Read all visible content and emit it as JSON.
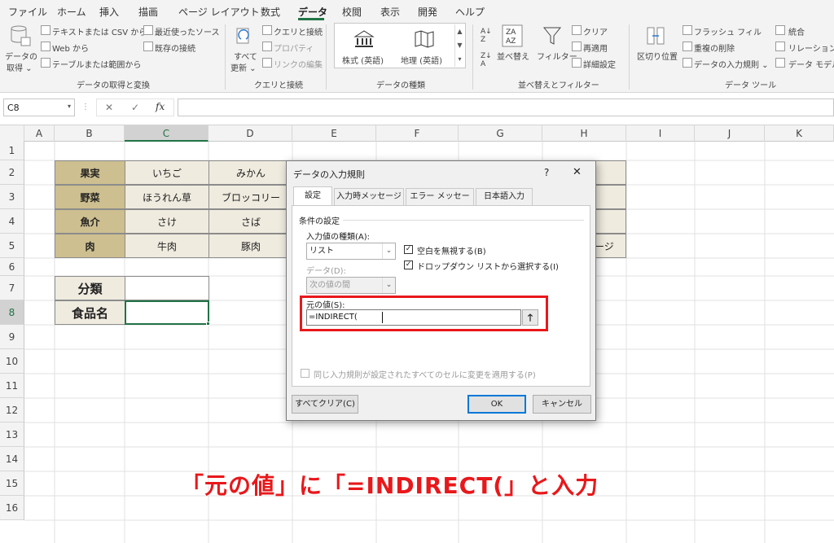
{
  "menu": {
    "items": [
      "ファイル",
      "ホーム",
      "挿入",
      "描画",
      "ページ レイアウト",
      "数式",
      "データ",
      "校閲",
      "表示",
      "開発",
      "ヘルプ"
    ],
    "active_index": 6
  },
  "ribbon": {
    "get_data": {
      "label_1": "データの",
      "label_2": "取得 ⌄"
    },
    "text_csv": "テキストまたは CSV から",
    "web": "Web から",
    "table_range": "テーブルまたは範囲から",
    "recent_sources": "最近使ったソース",
    "existing_conn": "既存の接続",
    "group_get_transform": "データの取得と変換",
    "refresh_1": "すべて",
    "refresh_2": "更新 ⌄",
    "queries_conn": "クエリと接続",
    "properties": "プロパティ",
    "edit_links": "リンクの編集",
    "group_queries": "クエリと接続",
    "stocks": "株式 (英語)",
    "geography": "地理 (英語)",
    "group_datatypes": "データの種類",
    "sort": "並べ替え",
    "filter": "フィルター",
    "clear": "クリア",
    "reapply": "再適用",
    "advanced": "詳細設定",
    "group_sort_filter": "並べ替えとフィルター",
    "text_to_columns": "区切り位置",
    "flash_fill": "フラッシュ フィル",
    "remove_dupes": "重複の削除",
    "data_validation": "データの入力規則 ⌄",
    "group_data_tools": "データ ツール",
    "consolidate": "統合",
    "relationships": "リレーションシップ",
    "data_model": "データ モデルの"
  },
  "formula_bar": {
    "name_box": "C8",
    "fx": "fx",
    "cancel": "✕",
    "enter": "✓",
    "value": ""
  },
  "grid": {
    "columns": [
      "A",
      "B",
      "C",
      "D",
      "E",
      "F",
      "G",
      "H",
      "I",
      "J",
      "K"
    ],
    "rows": [
      "1",
      "2",
      "3",
      "4",
      "5",
      "6",
      "7",
      "8",
      "9",
      "10",
      "11",
      "12",
      "13",
      "14",
      "15",
      "16"
    ],
    "selected_col": "C",
    "selected_row": "8",
    "table": [
      [
        "果実",
        "いちご",
        "みかん"
      ],
      [
        "野菜",
        "ほうれん草",
        "ブロッコリー"
      ],
      [
        "魚介",
        "さけ",
        "さば"
      ],
      [
        "肉",
        "牛肉",
        "豚肉"
      ]
    ],
    "h5_partial": "ージ",
    "input_labels": [
      "分類",
      "食品名"
    ]
  },
  "dialog": {
    "title": "データの入力規則",
    "help": "?",
    "close": "✕",
    "tabs": [
      "設定",
      "入力時メッセージ",
      "エラー メッセージ",
      "日本語入力"
    ],
    "section": "条件の設定",
    "allow_label": "入力値の種類(A):",
    "allow_value": "リスト",
    "ignore_blank": "空白を無視する(B)",
    "dropdown": "ドロップダウン リストから選択する(I)",
    "data_label": "データ(D):",
    "data_value": "次の値の間",
    "source_label": "元の値(S):",
    "source_value": "=INDIRECT(",
    "apply_all": "同じ入力規則が設定されたすべてのセルに変更を適用する(P)",
    "clear_all": "すべてクリア(C)",
    "ok": "OK",
    "cancel": "キャンセル"
  },
  "caption": "「元の値」に「=INDIRECT(」と入力",
  "colors": {
    "accent_green": "#217346",
    "highlight_red": "#e8181b",
    "table_header": "#cdbf8f",
    "table_body": "#efebdf"
  }
}
